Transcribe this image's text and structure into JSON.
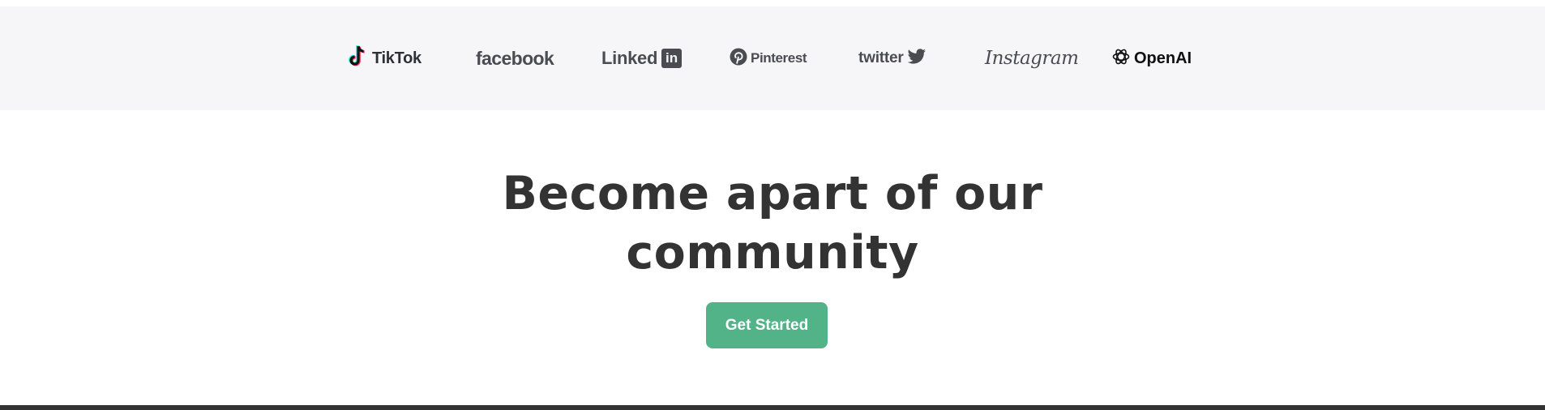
{
  "logos": {
    "tiktok": {
      "label": "TikTok",
      "icon": "tiktok-note-icon"
    },
    "facebook": {
      "label": "facebook"
    },
    "linkedin": {
      "label": "Linked",
      "badge": "in"
    },
    "pinterest": {
      "label": "Pinterest",
      "icon": "pinterest-p-icon"
    },
    "twitter": {
      "label": "twitter",
      "icon": "twitter-bird-icon"
    },
    "instagram": {
      "label": "Instagram"
    },
    "openai": {
      "label": "OpenAI",
      "icon": "openai-knot-icon"
    }
  },
  "hero": {
    "title_line1": "Become apart of our",
    "title_line2": "community",
    "cta_label": "Get Started"
  },
  "colors": {
    "logo_bar_bg": "#f6f6f8",
    "logo_gray": "#4b4c52",
    "heading": "#333333",
    "cta_bg": "#52b389",
    "footer": "#333333"
  }
}
